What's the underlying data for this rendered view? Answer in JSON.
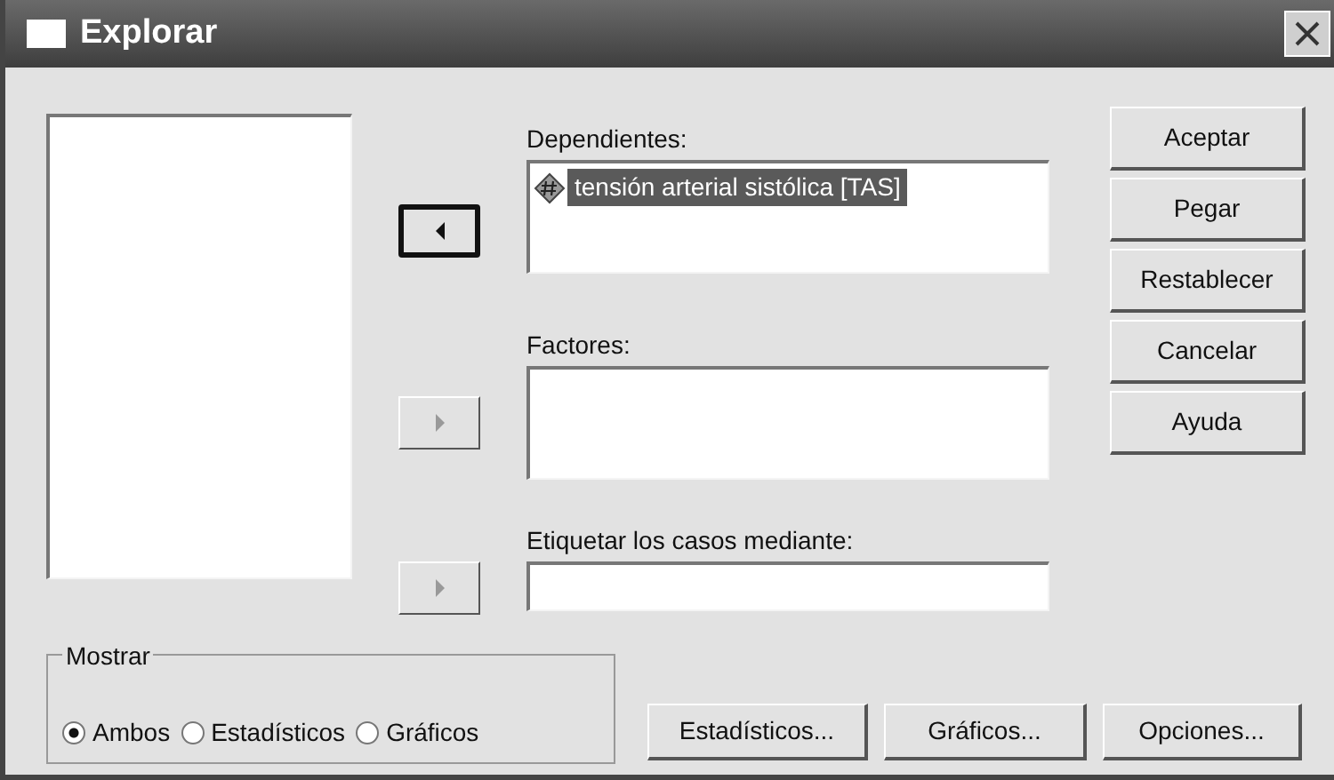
{
  "window": {
    "title": "Explorar"
  },
  "targets": [
    {
      "label": "Dependientes:",
      "arrow_left": true,
      "enabled": true,
      "kind": "list",
      "items": [
        {
          "text": "tensión arterial sistólica [TAS]",
          "selected": true
        }
      ]
    },
    {
      "label": "Factores:",
      "arrow_left": false,
      "enabled": false,
      "kind": "list"
    },
    {
      "label": "Etiquetar los casos mediante:",
      "arrow_left": false,
      "enabled": false,
      "kind": "field"
    }
  ],
  "action_buttons": [
    "Aceptar",
    "Pegar",
    "Restablecer",
    "Cancelar",
    "Ayuda"
  ],
  "display": {
    "legend": "Mostrar",
    "options": [
      {
        "label": "Ambos",
        "selected": true
      },
      {
        "label": "Estadísticos",
        "selected": false
      },
      {
        "label": "Gráficos",
        "selected": false
      }
    ]
  },
  "sub_buttons": [
    "Estadísticos...",
    "Gráficos...",
    "Opciones..."
  ]
}
